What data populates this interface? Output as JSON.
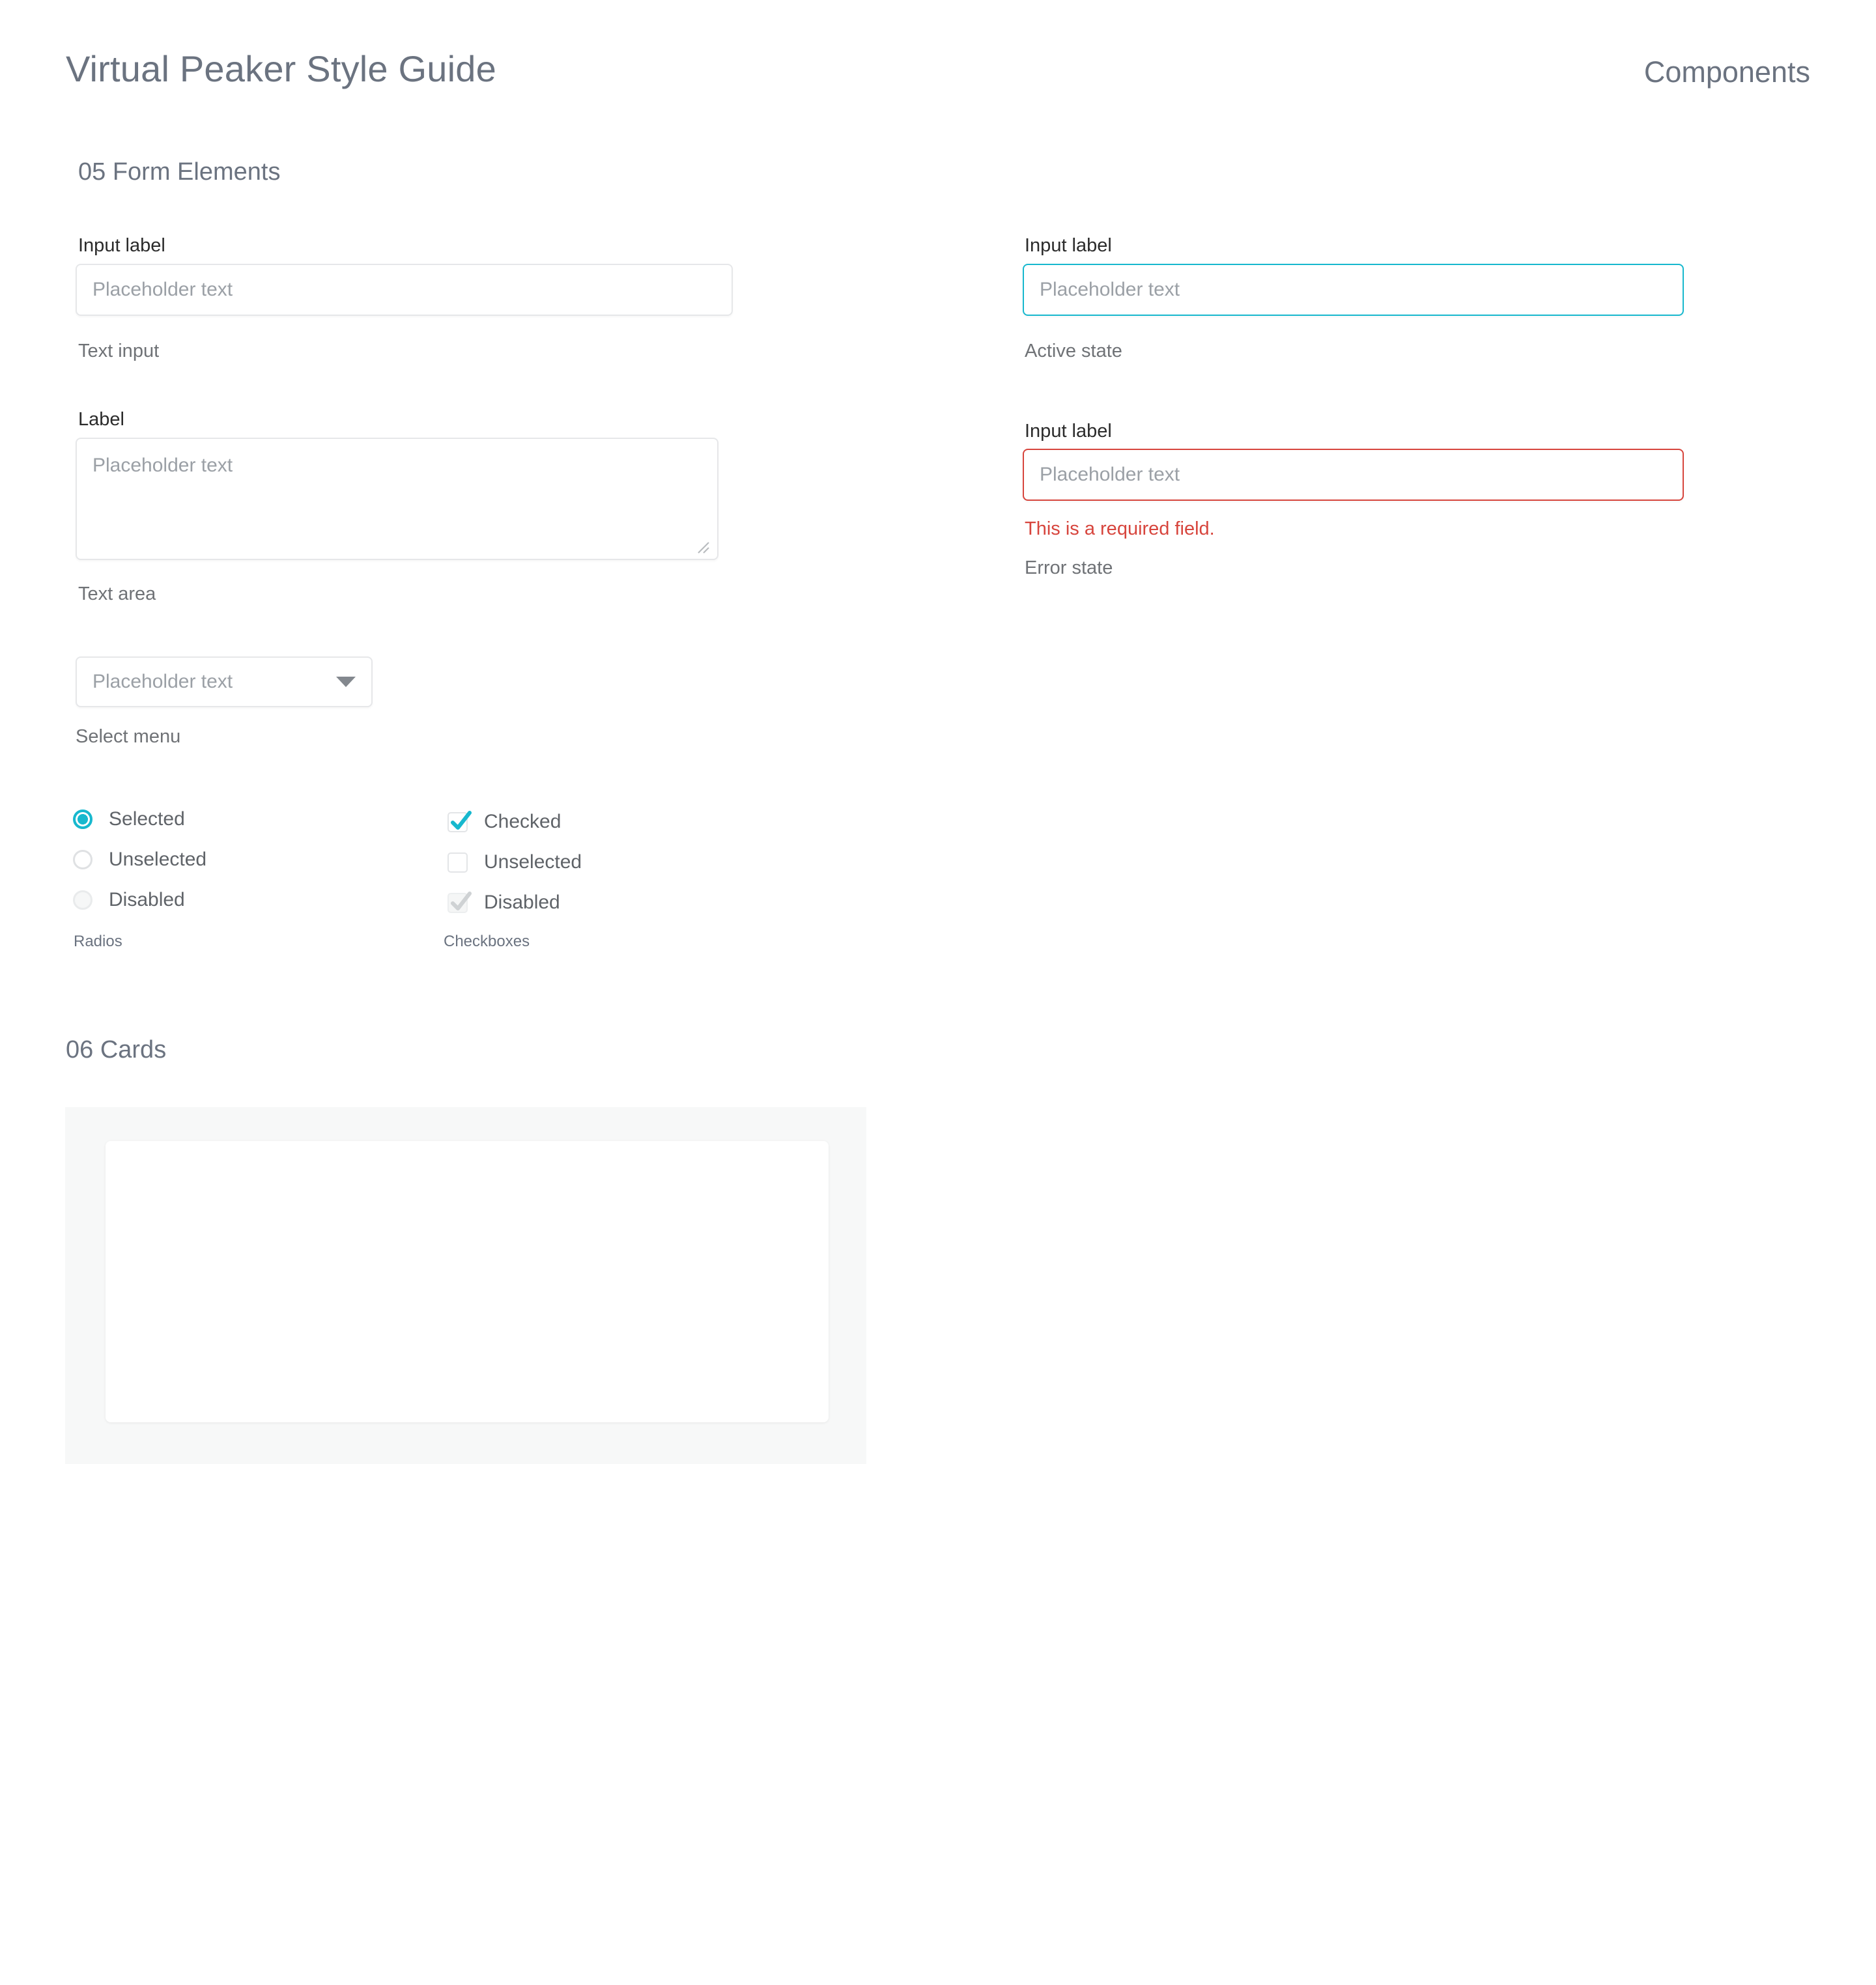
{
  "header": {
    "title": "Virtual Peaker Style Guide",
    "kicker": "Components"
  },
  "sections": {
    "form_elements": {
      "heading": "05 Form Elements",
      "text_input": {
        "label": "Input label",
        "placeholder": "Placeholder text",
        "value": "",
        "caption": "Text input"
      },
      "text_area": {
        "label": "Label",
        "placeholder": "Placeholder text",
        "value": "",
        "caption": "Text area"
      },
      "select_menu": {
        "value": "Placeholder text",
        "caption": "Select menu",
        "caret_icon": "chevron-down-icon"
      },
      "active_input": {
        "label": "Input label",
        "placeholder": "Placeholder text",
        "value": "",
        "caption": "Active state"
      },
      "error_input": {
        "label": "Input label",
        "placeholder": "Placeholder text",
        "value": "",
        "error_message": "This is a required field.",
        "caption": "Error state"
      },
      "radios": {
        "caption": "Radios",
        "items": [
          {
            "label": "Selected",
            "state": "selected"
          },
          {
            "label": "Unselected",
            "state": "unselected"
          },
          {
            "label": "Disabled",
            "state": "disabled"
          }
        ]
      },
      "checkboxes": {
        "caption": "Checkboxes",
        "items": [
          {
            "label": "Checked",
            "state": "checked"
          },
          {
            "label": "Unselected",
            "state": "unchecked"
          },
          {
            "label": "Disabled",
            "state": "disabled"
          }
        ]
      }
    },
    "cards": {
      "heading": "06 Cards"
    }
  },
  "colors": {
    "accent_teal": "#17b8ce",
    "error_red": "#d7453d",
    "heading_gray": "#6b7380",
    "label_dark": "#2b2b2b",
    "caption_gray": "#6f7276",
    "border_gray": "#e6e7e9",
    "card_backdrop": "#f7f8f8",
    "page_background": "#ffffff"
  }
}
